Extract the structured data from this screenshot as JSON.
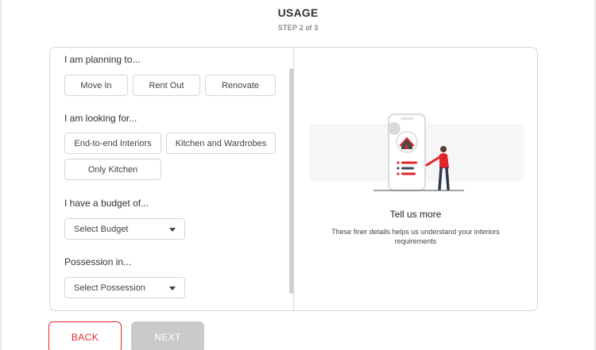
{
  "header": {
    "title": "USAGE",
    "step": "STEP 2 of 3"
  },
  "planning": {
    "question": "I am planning to...",
    "options": [
      "Move In",
      "Rent Out",
      "Renovate"
    ]
  },
  "looking": {
    "question": "I am looking for...",
    "options": [
      "End-to-end Interiors",
      "Kitchen and Wardrobes",
      "Only Kitchen"
    ]
  },
  "budget": {
    "question": "I have a budget of...",
    "select_value": "Select Budget"
  },
  "possession": {
    "question": "Possession in...",
    "select_value": "Select Possession"
  },
  "info": {
    "title": "Tell us more",
    "subtitle": "These finer details helps us understand your interiors requirements"
  },
  "buttons": {
    "back": "BACK",
    "next": "NEXT"
  },
  "colors": {
    "accent": "#e0262b",
    "disabled": "#cacaca"
  }
}
